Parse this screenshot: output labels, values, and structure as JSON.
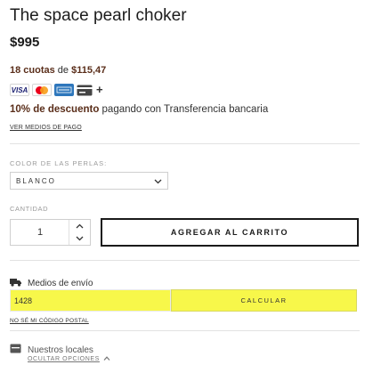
{
  "product": {
    "title": "The space pearl choker",
    "price": "$995"
  },
  "payment": {
    "installments_count": "18 cuotas",
    "installments_of": " de ",
    "installments_amount": "$115,47",
    "cards": [
      "visa",
      "mastercard",
      "amex",
      "generic-card"
    ],
    "visa_label": "VISA",
    "amex_label": "AMERICAN EXPRESS",
    "more_symbol": "+",
    "discount_bold": "10% de descuento",
    "discount_rest": " pagando con Transferencia bancaria",
    "see_methods_link": "VER MEDIOS DE PAGO"
  },
  "variant": {
    "label": "COLOR DE LAS PERLAS:",
    "selected": "BLANCO"
  },
  "quantity": {
    "label": "CANTIDAD",
    "value": "1"
  },
  "cart": {
    "add_label": "AGREGAR AL CARRITO"
  },
  "shipping": {
    "label": "Medios de envío",
    "postal_code": "1428",
    "calculate_label": "CALCULAR",
    "unknown_cp_link": "NO SÉ MI CÓDIGO POSTAL",
    "highlight_color": "#f7f74a"
  },
  "stores": {
    "label": "Nuestros locales",
    "hide_options_link": "OCULTAR OPCIONES"
  }
}
